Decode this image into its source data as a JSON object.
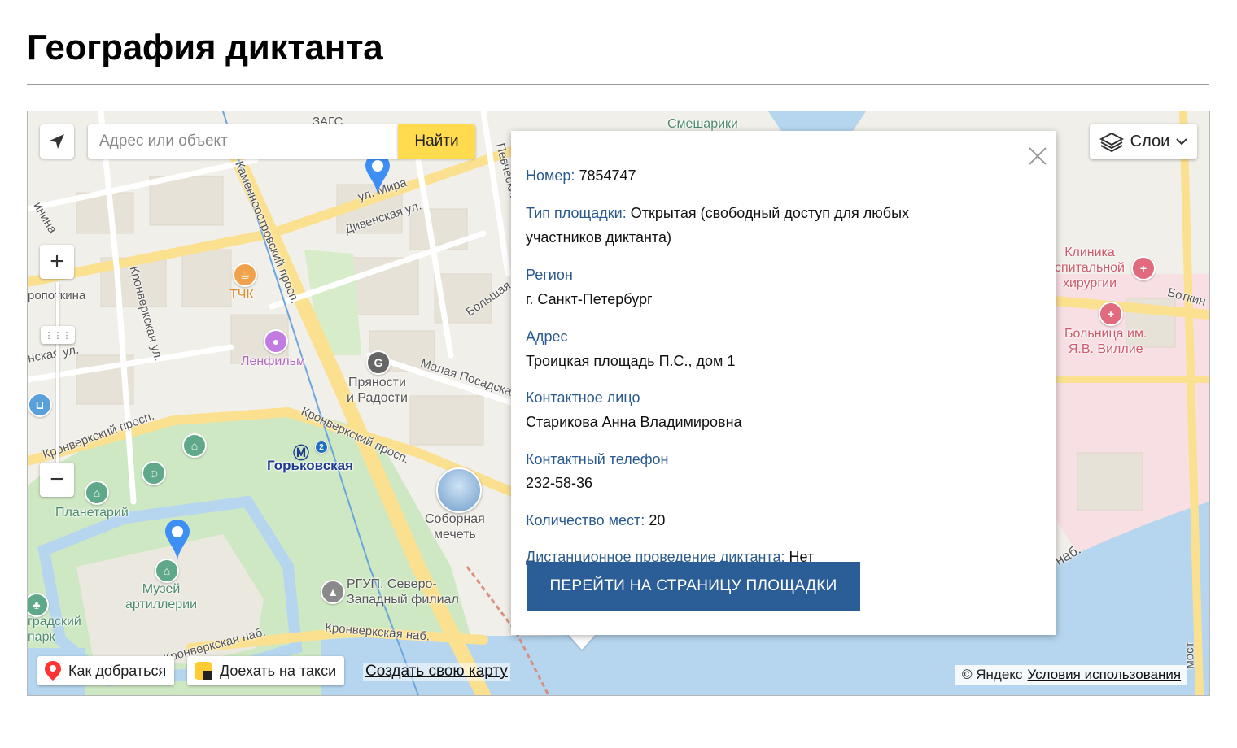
{
  "page": {
    "title": "География диктанта"
  },
  "search": {
    "placeholder": "Адрес или объект",
    "button_label": "Найти"
  },
  "layers": {
    "label": "Слои",
    "icon": "layers-icon"
  },
  "bottom": {
    "route_label": "Как добраться",
    "taxi_label": "Доехать на такси",
    "create_map_label": "Создать свою карту"
  },
  "copyright": {
    "text": "© Яндекс",
    "terms_label": "Условия использования"
  },
  "map_labels": {
    "zags": "ЗАГС",
    "smeshariki": "Смешарики",
    "ul_mira": "ул. Мира",
    "divenskaya": "Дивенская ул.",
    "kamennoostrovsky": "Каменноостровский просп.",
    "kronverksky_ul": "Кронверкская ул.",
    "kronverksky_prosp_1": "Кронверкский просп.",
    "kronverksky_prosp_2": "Кронверкский просп.",
    "kronverkskaya_nab_1": "Кронверкская наб.",
    "kronverkskaya_nab_2": "Кронверкская наб.",
    "malaya_posadskaya": "Малая Посадская",
    "bolshaya": "Большая",
    "nevsky_per": "Певческий пер.",
    "botkin": "Боткин",
    "tchk": "ТЧК",
    "lenfilm": "Ленфильм",
    "pryanosti_1": "Пряности",
    "pryanosti_2": "и Радости",
    "gorkovskaya": "Горьковская",
    "metro_line": "2",
    "planetarium": "Планетарий",
    "muzey_1": "Музей",
    "muzey_2": "артиллерии",
    "mosque_1": "Соборная",
    "mosque_2": "мечеть",
    "rgup_1": "РГУП, Северо-",
    "rgup_2": "Западный филиал",
    "park_1": "градский",
    "park_2": "парк",
    "clinic_1": "Клиника",
    "clinic_2": "спитальной",
    "clinic_3": "хирургии",
    "hospital_1": "Больница им.",
    "hospital_2": "Я.В. Виллие",
    "left_1": "инина",
    "left_2": "ропоткина",
    "left_3": "нская ул.",
    "nab_right": "наб.",
    "most": "мост"
  },
  "balloon": {
    "number_key": "Номер:",
    "number_val": "7854747",
    "type_key": "Тип площадки:",
    "type_val": "Открытая (свободный доступ для любых участников диктанта)",
    "region_key": "Регион",
    "region_val": "г. Санкт-Петербург",
    "address_key": "Адрес",
    "address_val": "Троицкая площадь П.С., дом 1",
    "contact_key": "Контактное лицо",
    "contact_val": "Старикова Анна Владимировна",
    "phone_key": "Контактный телефон",
    "phone_val": "232-58-36",
    "seats_key": "Количество мест:",
    "seats_val": "20",
    "remote_key": "Дистанционное проведение диктанта:",
    "remote_val": "Нет",
    "goto_label": "ПЕРЕЙТИ НА СТРАНИЦУ ПЛОЩАДКИ"
  },
  "colors": {
    "accent_button": "#2b5d96",
    "label_blue": "#2a5a8e",
    "search_button": "#ffdb4d",
    "map_water": "#b6d6ef",
    "map_park": "#cfe8c4",
    "map_road": "#fbe18f",
    "pin_blue": "#3d8ef5"
  }
}
